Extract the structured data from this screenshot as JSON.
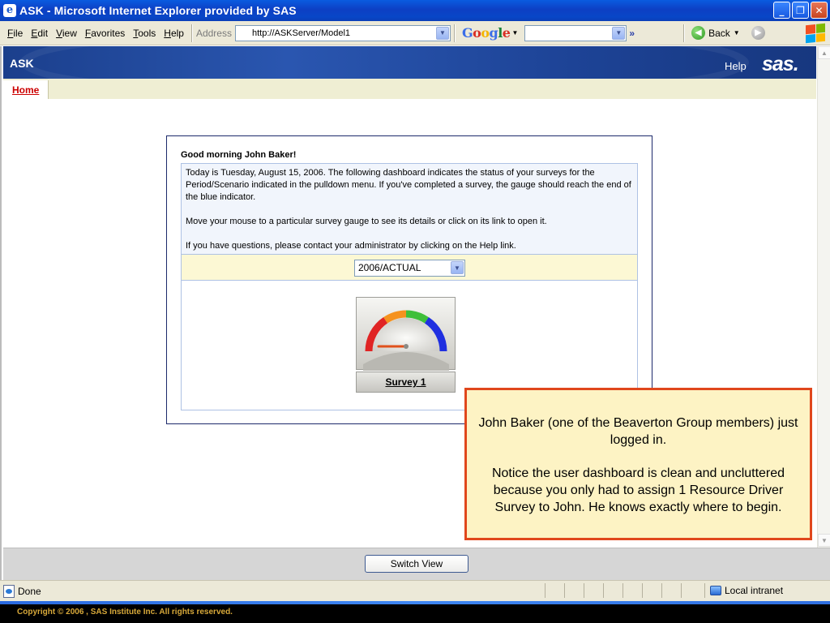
{
  "window": {
    "title": "ASK - Microsoft Internet Explorer provided by SAS",
    "minimize": "_",
    "maximize": "❐",
    "close": "✕"
  },
  "menu": [
    "File",
    "Edit",
    "View",
    "Favorites",
    "Tools",
    "Help"
  ],
  "address": {
    "label": "Address",
    "url": "http://ASKServer/Model1"
  },
  "google": {
    "logo": "Google",
    "search_value": "",
    "more": "»"
  },
  "nav": {
    "back_label": "Back"
  },
  "app": {
    "name": "ASK",
    "help_label": "Help",
    "logo_text": "sas.",
    "tab_home": "Home"
  },
  "dashboard": {
    "greeting": "Good morning John Baker!",
    "info": [
      "Today is Tuesday, August 15, 2006. The following dashboard indicates the status of your surveys for the Period/Scenario indicated in the pulldown menu. If you've completed a survey, the gauge should reach the end of the blue indicator.",
      "Move your mouse to a particular survey gauge to see its details or click on its link to open it.",
      "If you have questions, please contact your administrator by clicking on the Help link."
    ],
    "period_select": "2006/ACTUAL",
    "surveys": [
      {
        "label": "Survey 1",
        "gauge_progress": 0.0
      }
    ]
  },
  "callout": {
    "line1": "John Baker (one of the Beaverton Group members) just logged in.",
    "line2": "Notice the user dashboard is clean and uncluttered because you only had to assign 1 Resource Driver Survey to John. He knows exactly where to begin."
  },
  "switch_view_label": "Switch View",
  "status": {
    "text": "Done",
    "zone": "Local intranet"
  },
  "footer": {
    "copyright": "Copyright © 2006 , SAS Institute Inc. All rights reserved."
  },
  "colors": {
    "title_bar": "#0d3fc4",
    "sas_banner": "#2a56b0",
    "home_tab": "#cc0000",
    "callout_border": "#e0471c",
    "callout_bg": "#fdf3c4",
    "gauge_red": "#e02424",
    "gauge_orange": "#f5921e",
    "gauge_green": "#3fbf3a",
    "gauge_blue": "#1f2fe0",
    "footer_text": "#d8a93a"
  },
  "icons": {
    "ie": "ie-icon",
    "back": "back-arrow-icon",
    "forward": "forward-arrow-icon",
    "windows_logo": "windows-logo-icon",
    "status_page": "page-icon",
    "zone": "local-intranet-icon"
  }
}
